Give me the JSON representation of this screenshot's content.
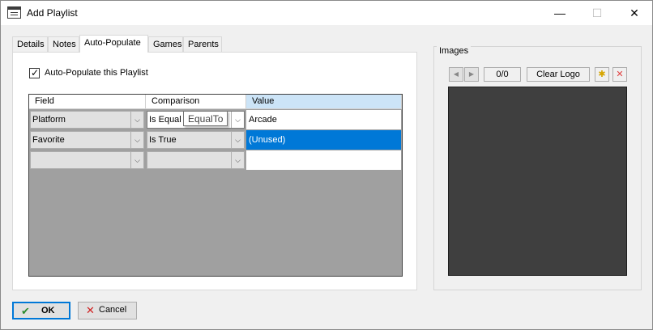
{
  "window": {
    "title": "Add Playlist",
    "minimize_glyph": "—",
    "maximize_glyph": "☐",
    "close_glyph": "✕"
  },
  "tabs": [
    {
      "label": "Details",
      "active": false
    },
    {
      "label": "Notes",
      "active": false
    },
    {
      "label": "Auto-Populate",
      "active": true
    },
    {
      "label": "Games",
      "active": false
    },
    {
      "label": "Parents",
      "active": false
    }
  ],
  "auto_populate": {
    "checkbox_label": "Auto-Populate this Playlist",
    "checked": true,
    "check_glyph": "✓"
  },
  "grid": {
    "columns": [
      "Field",
      "Comparison",
      "Value"
    ],
    "rows": [
      {
        "field": "Platform",
        "comparison": "Is Equal T",
        "value": "Arcade",
        "selected": false
      },
      {
        "field": "Favorite",
        "comparison": "Is True",
        "value": "(Unused)",
        "selected": true
      },
      {
        "field": "",
        "comparison": "",
        "value": "",
        "selected": false
      }
    ],
    "dropdown_glyph": "⌵"
  },
  "tooltip": {
    "text": "EqualTo"
  },
  "images": {
    "group_label": "Images",
    "prev_icon": "◀",
    "next_icon": "▶",
    "counter": "0/0",
    "clear_button": "Clear Logo",
    "add_icon": "✱",
    "delete_icon": "✕"
  },
  "footer": {
    "ok_label": "OK",
    "ok_icon": "✔",
    "cancel_label": "Cancel",
    "cancel_icon": "✕"
  },
  "colors": {
    "selection": "#0078d7",
    "header_selected": "#cce4f7",
    "ok_icon": "#2e8b2e",
    "cancel_icon": "#d01f1f",
    "image_area": "#3f3f3f"
  }
}
